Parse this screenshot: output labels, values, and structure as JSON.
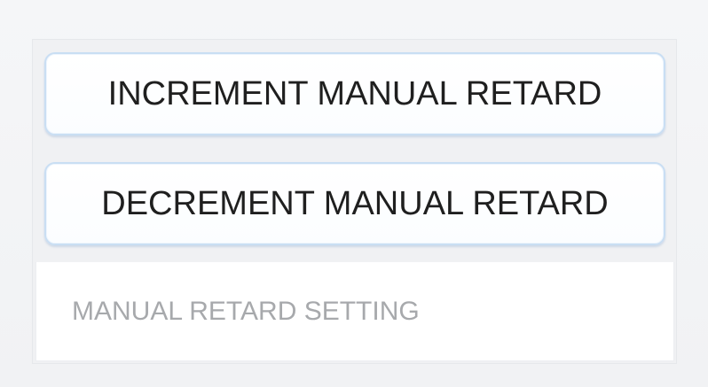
{
  "controls": {
    "increment_label": "INCREMENT MANUAL RETARD",
    "decrement_label": "DECREMENT MANUAL RETARD"
  },
  "setting": {
    "value": "",
    "placeholder": "MANUAL RETARD SETTING"
  },
  "colors": {
    "button_border": "#c9def3",
    "background": "#f3f4f6",
    "placeholder_text": "#a7a9ac"
  }
}
